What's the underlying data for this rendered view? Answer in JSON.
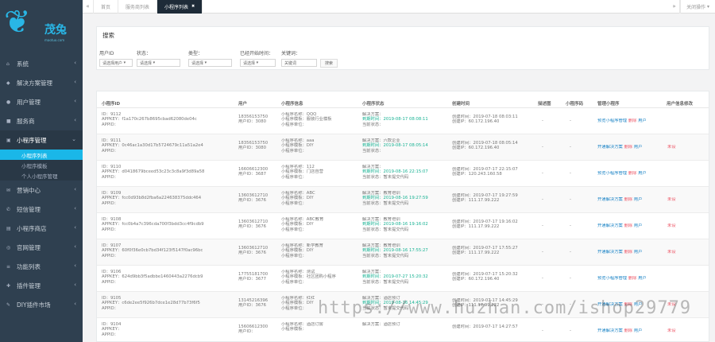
{
  "brand": {
    "symbol": "❦",
    "name": "茂兔",
    "sub": "maotuo.com"
  },
  "sidebar": {
    "items": [
      {
        "label": "系统",
        "icon": "home-icon"
      },
      {
        "label": "解决方案管理",
        "icon": "solution-icon"
      },
      {
        "label": "用户管理",
        "icon": "user-icon"
      },
      {
        "label": "服务商",
        "icon": "provider-icon"
      },
      {
        "label": "小程序管理",
        "icon": "app-icon",
        "open": true
      },
      {
        "label": "营销中心",
        "icon": "marketing-icon"
      },
      {
        "label": "短信管理",
        "icon": "sms-icon"
      },
      {
        "label": "小程序商店",
        "icon": "store-icon"
      },
      {
        "label": "官网管理",
        "icon": "site-icon"
      },
      {
        "label": "功能列表",
        "icon": "feature-icon"
      },
      {
        "label": "插件管理",
        "icon": "plugin-icon"
      },
      {
        "label": "DIY插件市场",
        "icon": "diy-icon"
      }
    ],
    "subitems": [
      "小程序列表",
      "小程序模板",
      "个人小程序管理"
    ]
  },
  "tabs": [
    "首页",
    "服务商列表",
    "小程序列表"
  ],
  "topbar": {
    "right": "关闭操作"
  },
  "search": {
    "title": "搜索",
    "labels": [
      "用户ID",
      "状态：",
      "类型：",
      "已经开始时间：",
      "关键词："
    ],
    "placeholders": [
      "请选择用户",
      "请选择",
      "请选择",
      "请选择",
      "关键词"
    ],
    "button": "搜索"
  },
  "table": {
    "headers": [
      "小程序ID",
      "用户",
      "小程序信息",
      "小程序状态",
      "创建时间",
      "描述图",
      "小程序码",
      "管理小程序",
      "用户信息修改"
    ],
    "rows": [
      {
        "id": [
          "ID：9112",
          "APPKEY：f1a170c267b8695cbad62080de04c",
          "APPID："
        ],
        "user": [
          "18356153750",
          "用户ID：3080"
        ],
        "info": [
          "小程序名称：QQQ",
          "小程序模板：服装行业模板",
          "小程序单位："
        ],
        "status": [
          "解决方案：",
          "到期时间：2019-08-17 08:08:11",
          "当前状态："
        ],
        "created": [
          "创建时间：2019-07-18 08:03:11",
          "创建IP：60.172.196.40"
        ],
        "desc": "-",
        "qr": "-",
        "manage": [
          "预览小程序管理",
          "删除",
          "用户"
        ],
        "modify": ""
      },
      {
        "id": [
          "ID：9111",
          "APPKEY：0c46ac1a30d17b5724679c11a51a2e4",
          "APPID："
        ],
        "user": [
          "18356153750",
          "用户ID：3080"
        ],
        "info": [
          "小程序名称：aaa",
          "小程序模板：DIY",
          "小程序单位："
        ],
        "status": [
          "解决方案：六款企业",
          "到期时间：2019-08-17 08:05:14",
          "当前状态："
        ],
        "created": [
          "创建时间：2019-07-18 08:05:14",
          "创建IP：60.172.196.40"
        ],
        "desc": "-",
        "qr": "-",
        "manage": [
          "开通解决方案",
          "删除",
          "用户"
        ],
        "modify": "未设"
      },
      {
        "id": [
          "ID：9110",
          "APPKEY：d0418679bceed53c23c3c8a9f3d89a58",
          "APPID："
        ],
        "user": [
          "16606612300",
          "用户ID：3687"
        ],
        "info": [
          "小程序名称：112",
          "小程序模板：门店自营",
          "小程序单位："
        ],
        "status": [
          "解决方案：",
          "到期时间：2019-08-16 22:15:07",
          "当前状态：暂未提交代码"
        ],
        "created": [
          "创建时间：2019-07-17 22:15:07",
          "创建IP：120.243.160.58"
        ],
        "desc": "-",
        "qr": "-",
        "manage": [
          "预览小程序管理",
          "删除",
          "用户"
        ],
        "modify": ""
      },
      {
        "id": [
          "ID：9109",
          "APPKEY：fcc0d93b8d2fba6a224638375ddc464",
          "APPID："
        ],
        "user": [
          "13603612710",
          "用户ID：3676"
        ],
        "info": [
          "小程序名称：ABC",
          "小程序模板：DIY",
          "小程序单位："
        ],
        "status": [
          "解决方案：教育培训",
          "到期时间：2019-08-16 19:27:59",
          "当前状态：暂未提交代码"
        ],
        "created": [
          "创建时间：2019-07-17 19:27:59",
          "创建IP：111.17.99.222"
        ],
        "desc": "-",
        "qr": "-",
        "manage": [
          "开通解决方案",
          "删除",
          "用户"
        ],
        "modify": "未设"
      },
      {
        "id": [
          "ID：9108",
          "APPKEY：fcc0b4a7c396cda700f3bdd3cc4f9cdb9",
          "APPID："
        ],
        "user": [
          "13603612710",
          "用户ID：3676"
        ],
        "info": [
          "小程序名称：ABC教育",
          "小程序模板：DIY",
          "小程序单位："
        ],
        "status": [
          "解决方案：教育培训",
          "到期时间：2019-08-16 19:16:02",
          "当前状态：暂未提交代码"
        ],
        "created": [
          "创建时间：2019-07-17 19:16:02",
          "创建IP：111.17.99.222"
        ],
        "desc": "-",
        "qr": "-",
        "manage": [
          "开通解决方案",
          "删除",
          "用户"
        ],
        "modify": "未设"
      },
      {
        "id": [
          "ID：9107",
          "APPKEY：60f0f36e0cb7bd34f123f5147f0ac96bc",
          "APPID："
        ],
        "user": [
          "13603612710",
          "用户ID：3676"
        ],
        "info": [
          "小程序名称：新学教育",
          "小程序模板：DIY",
          "小程序单位："
        ],
        "status": [
          "解决方案：教育培训",
          "到期时间：2019-08-16 17:55:27",
          "当前状态：暂未提交代码"
        ],
        "created": [
          "创建时间：2019-07-17 17:55:27",
          "创建IP：111.17.99.222"
        ],
        "desc": "-",
        "qr": "-",
        "manage": [
          "开通解决方案",
          "删除",
          "用户"
        ],
        "modify": "未设"
      },
      {
        "id": [
          "ID：9106",
          "APPKEY：624d9bb3f5adbbe1460443a2276dcb9",
          "APPID："
        ],
        "user": [
          "17755181700",
          "用户ID：3677"
        ],
        "info": [
          "小程序名称：测试",
          "小程序模板：社区团购小程序",
          "小程序单位："
        ],
        "status": [
          "解决方案：",
          "到期时间：2019-07-27 15:20:32",
          "当前状态：暂未提交代码"
        ],
        "created": [
          "创建时间：2019-07-17 15:20:32",
          "创建IP：60.172.196.40"
        ],
        "desc": "-",
        "qr": "-",
        "manage": [
          "预览小程序管理",
          "删除",
          "用户"
        ],
        "modify": ""
      },
      {
        "id": [
          "ID：9105",
          "APPKEY：c6de2ee5f926b7dce1e28d77b73f6f5",
          "APPID："
        ],
        "user": [
          "13145216396",
          "用户ID：3676"
        ],
        "info": [
          "小程序名称：红红",
          "小程序模板：DIY",
          "小程序单位："
        ],
        "status": [
          "解决方案：酒店预订",
          "到期时间：2019-08-16 14:45:29",
          "当前状态：暂未提交代码"
        ],
        "created": [
          "创建时间：2019-07-17 14:45:29",
          "创建IP：111.17.99.222"
        ],
        "desc": "-",
        "qr": "-",
        "manage": [
          "开通解决方案",
          "删除",
          "用户"
        ],
        "modify": "未设"
      },
      {
        "id": [
          "ID：9104",
          "APPKEY：",
          "APPID："
        ],
        "user": [
          "15606612300",
          "用户ID："
        ],
        "info": [
          "小程序名称：酒店订房",
          "小程序模板：",
          ""
        ],
        "status": [
          "解决方案：酒店预订",
          "",
          ""
        ],
        "created": [
          "创建时间：2019-07-17 14:27:57",
          ""
        ],
        "desc": "-",
        "qr": "-",
        "manage": [
          "开通解决方案",
          "删除",
          "用户"
        ],
        "modify": "未设"
      }
    ]
  },
  "watermark": "https://www.huzhan.com/ishop29779"
}
